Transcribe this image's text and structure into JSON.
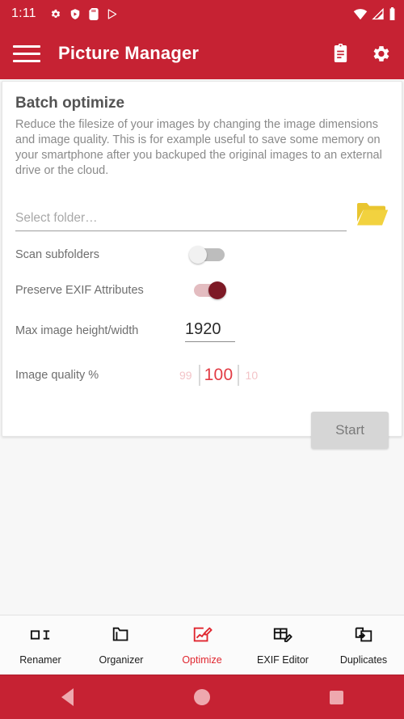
{
  "status_bar": {
    "time": "1:11",
    "left_icons": [
      "gear-icon",
      "play-protect-icon",
      "sd-card-icon",
      "play-store-icon"
    ],
    "right_icons": [
      "wifi-icon",
      "cell-signal-icon",
      "battery-icon"
    ]
  },
  "app_bar": {
    "menu_icon": "hamburger-menu-icon",
    "title": "Picture Manager",
    "actions": [
      "clipboard-log-icon",
      "settings-gear-icon"
    ],
    "background_color": "#c62233"
  },
  "card": {
    "title": "Batch optimize",
    "description": "Reduce the filesize of your images by changing the image dimensions and image quality.\nThis is for example useful to save some memory on your smartphone after you backuped the original images to an external drive or the cloud.",
    "folder": {
      "placeholder": "Select folder…",
      "value": "",
      "browse_icon": "folder-open-icon",
      "browse_icon_color": "#e8c32e"
    },
    "switches": [
      {
        "label": "Scan subfolders",
        "state": "off"
      },
      {
        "label": "Preserve EXIF Attributes",
        "state": "on"
      }
    ],
    "max_size": {
      "label": "Max image height/width",
      "value": "1920"
    },
    "quality": {
      "label": "Image quality %",
      "previous": "99",
      "current": "100",
      "next": "10",
      "accent_color": "#e23b44"
    },
    "start_button": {
      "label": "Start",
      "enabled": false
    }
  },
  "bottom_nav": {
    "active_color": "#e0262f",
    "items": [
      {
        "label": "Renamer",
        "icon": "rename-text-cursor-icon",
        "active": false
      },
      {
        "label": "Organizer",
        "icon": "folder-icon",
        "active": false
      },
      {
        "label": "Optimize",
        "icon": "image-edit-icon",
        "active": true
      },
      {
        "label": "EXIF Editor",
        "icon": "table-edit-icon",
        "active": false
      },
      {
        "label": "Duplicates",
        "icon": "copy-arrow-icon",
        "active": false
      }
    ]
  },
  "android_nav": {
    "buttons": [
      "back-triangle-icon",
      "home-circle-icon",
      "recents-square-icon"
    ],
    "background_color": "#c62233"
  }
}
